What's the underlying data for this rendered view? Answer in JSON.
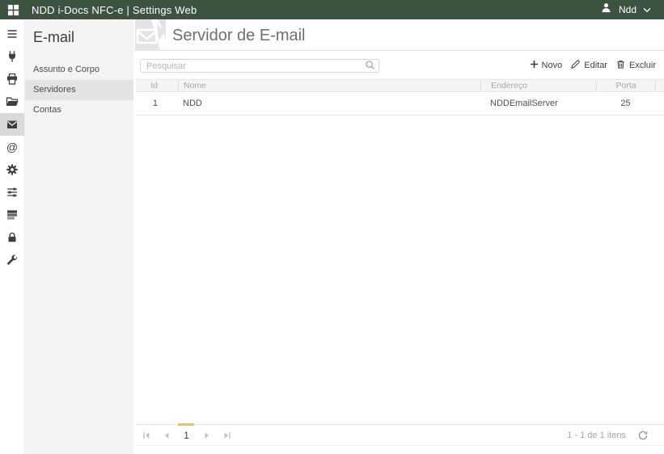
{
  "topbar": {
    "title": "NDD i-Docs NFC-e | Settings Web",
    "user_name": "Ndd"
  },
  "icon_strip": {
    "selected": "email",
    "icons": [
      "menu",
      "plug",
      "printer",
      "folder-open",
      "email",
      "at-sign",
      "gear",
      "sliders",
      "server",
      "lock",
      "wrench"
    ]
  },
  "sidebar": {
    "title": "E-mail",
    "items": [
      {
        "label": "Assunto e Corpo",
        "selected": false
      },
      {
        "label": "Servidores",
        "selected": true
      },
      {
        "label": "Contas",
        "selected": false
      }
    ]
  },
  "page": {
    "title": "Servidor de E-mail"
  },
  "toolbar": {
    "search_placeholder": "Pesquisar",
    "new_label": "Novo",
    "edit_label": "Editar",
    "delete_label": "Excluir"
  },
  "table": {
    "columns": [
      "Id",
      "Nome",
      "Endereço",
      "Porta"
    ],
    "rows": [
      {
        "id": "1",
        "nome": "NDD",
        "endereco": "NDDEmailServer",
        "porta": "25"
      }
    ]
  },
  "pager": {
    "current_page": "1",
    "items_text": "1 - 1 de 1 itens"
  },
  "colors": {
    "topbar_bg": "#3d5342",
    "accent_gold": "#d9c57d",
    "strip_selected_bg": "#d9d9d9",
    "sidebar_bg": "#f4f4f4",
    "sidebar_selected_bg": "#e4e4e4",
    "grid_header_bg": "#f5f5f5"
  }
}
